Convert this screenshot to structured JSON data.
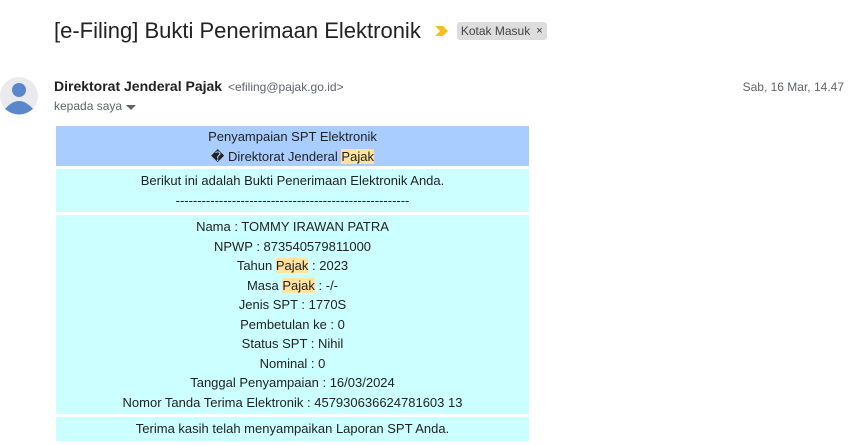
{
  "subject": "[e-Filing] Bukti Penerimaan Elektronik",
  "label": "Kotak Masuk",
  "label_remove": "×",
  "sender": {
    "name": "Direktorat Jenderal Pajak",
    "email": "<efiling@pajak.go.id>",
    "to": "kepada saya",
    "date": "Sab, 16 Mar, 14.47"
  },
  "body": {
    "header_line1": "Penyampaian SPT Elektronik",
    "header_line2_prefix": "� Direktorat Jenderal ",
    "header_line2_hl": "Pajak",
    "intro": "Berikut ini adalah Bukti Penerimaan Elektronik Anda.",
    "divider": "------------------------------------------------------",
    "nama": "Nama : TOMMY IRAWAN PATRA",
    "npwp": "NPWP : 873540579811000",
    "tahun_prefix": "Tahun ",
    "tahun_hl": "Pajak",
    "tahun_suffix": " : 2023",
    "masa_prefix": "Masa ",
    "masa_hl": "Pajak",
    "masa_suffix": " : -/-",
    "jenis": "Jenis SPT : 1770S",
    "pembetulan": "Pembetulan ke : 0",
    "status": "Status SPT : Nihil",
    "nominal": "Nominal : 0",
    "tanggal": "Tanggal Penyampaian : 16/03/2024",
    "nomor": "Nomor Tanda Terima Elektronik : 457930636624781603 13",
    "footer": "Terima kasih telah menyampaikan Laporan SPT Anda."
  },
  "colors": {
    "header_bg": "#a9cdff",
    "body_bg": "#ccffff",
    "highlight": "#ffe39e",
    "importance": "#f2c024"
  }
}
